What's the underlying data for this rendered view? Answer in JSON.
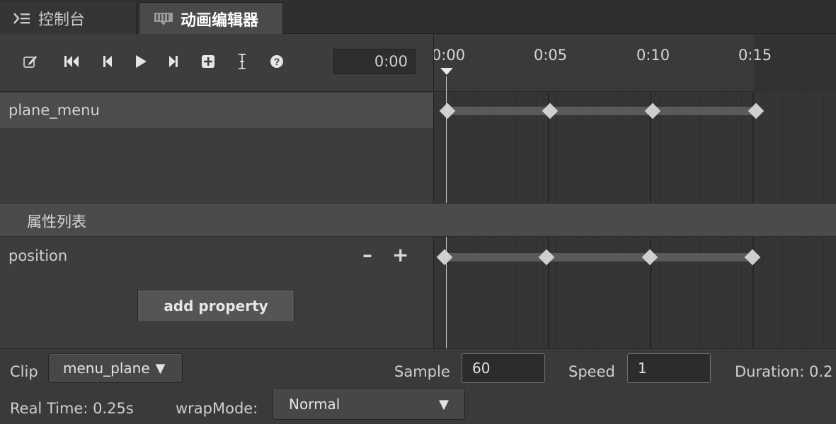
{
  "tabs": [
    {
      "label": "控制台",
      "icon": "console-icon"
    },
    {
      "label": "动画编辑器",
      "icon": "film-icon"
    }
  ],
  "toolbar": {
    "buttons": [
      "edit-icon",
      "jump-to-start-icon",
      "step-back-icon",
      "play-icon",
      "step-forward-icon",
      "add-keyframe-icon",
      "add-event-icon",
      "help-icon"
    ],
    "current_time": "0:00"
  },
  "timeline": {
    "ticks": [
      "0:00",
      "0:05",
      "0:10",
      "0:15"
    ]
  },
  "nodes": [
    {
      "label": "plane_menu"
    }
  ],
  "properties": {
    "section_title": "属性列表",
    "items": [
      {
        "label": "position"
      }
    ],
    "minus": "–",
    "plus": "+",
    "add_button": "add property"
  },
  "bottom": {
    "clip_label": "Clip",
    "clip_value": "menu_plane",
    "sample_label": "Sample",
    "sample_value": "60",
    "speed_label": "Speed",
    "speed_value": "1",
    "duration_label": "Duration: 0.2",
    "realtime_label": "Real Time: 0.25s",
    "wrapmode_label": "wrapMode:",
    "wrapmode_value": "Normal"
  }
}
